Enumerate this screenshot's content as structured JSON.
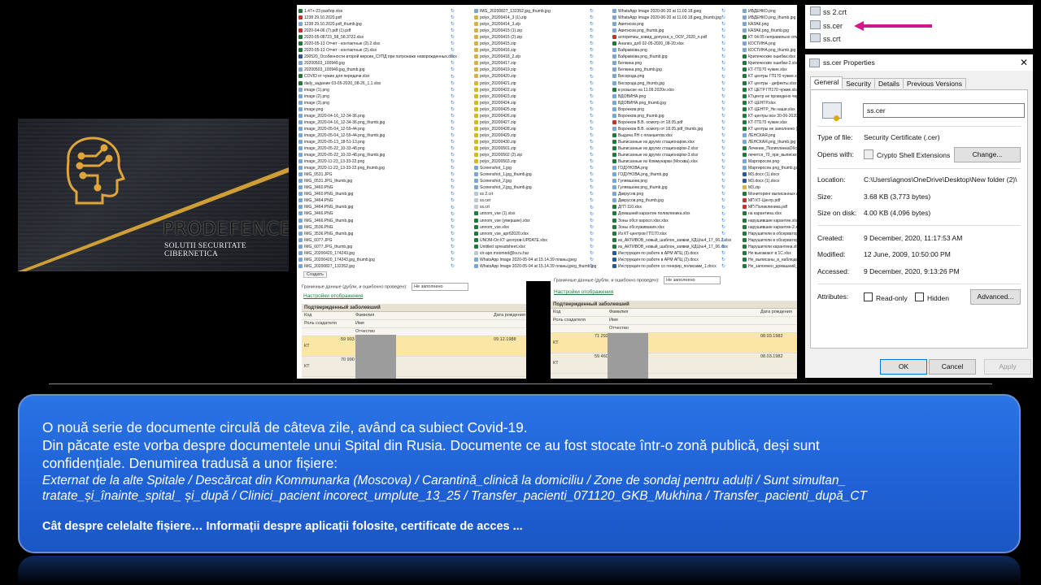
{
  "logo": {
    "brand": "PRODEFENCE",
    "tagline": "SOLUTII SECURITATE CIBERNETICA",
    "colors": {
      "gold": "#d9a437",
      "bg": "#1f2128"
    }
  },
  "listing": {
    "columns": [
      [
        "1.47+-23 разбор.xlsx",
        "1238 29.10.2020.pdf",
        "1238 29.10.2020.pdf_thumb.jpg",
        "2020-04-06 (7).pdf (1).pdf",
        "2020-05-08723_58_58.3722.xlsx",
        "2020-05-13 Отчет - контактные (2).2.xlsx",
        "2020-05-13 Отчет - контактные (2).xlsx",
        "200520_Особенности второй версии_СУПД при патронаже новорожденных.docx",
        "20200503_100949.jpg",
        "20200503_100949.jpg_thumb.jpg",
        "COVID кт чужие для передачи.xlsx",
        "daily_задание 03-05-2020_08-26_1,1.xlsx",
        "image (1).png",
        "image (2).png",
        "image (3).png",
        "image.png",
        "image_2020-04-16_12-34-36.png",
        "image_2020-04-16_12-34-36.png_thumb.jpg",
        "image_2020-05-04_12-59-44.png",
        "image_2020-05-04_12-59-44.png_thumb.jpg",
        "image_2020-05-13_18-51-13.png",
        "image_2020-05-22_10-33-48.png",
        "image_2020-05-22_10-33-48.png_thumb.jpg",
        "image_2020-11-23_13-33-22.png",
        "image_2020-11-23_13-33-22.png_thumb.jpg",
        "IMG_0531.JPG",
        "IMG_0531.JPG_thumb.jpg",
        "IMG_3460.PNG",
        "IMG_3460.PNG_thumb.jpg",
        "IMG_3464.PNG",
        "IMG_3464.PNG_thumb.jpg",
        "IMG_3466.PNG",
        "IMG_3466.PNG_thumb.jpg",
        "IMG_3536.PNG",
        "IMG_3536.PNG_thumb.jpg",
        "IMG_6077.JPG",
        "IMG_6077.JPG_thumb.jpg",
        "IMG_20200420_174243.jpg",
        "IMG_20200420_174243.jpg_thumb.jpg",
        "IMG_20200827_132352.jpg"
      ],
      [
        "IMG_20200827_132352.jpg_thumb.jpg",
        "polyx_20200414_3 (1).zip",
        "polyx_20200414_3.zip",
        "polyx_20200415 (1).zip",
        "polyx_20200415 (2).zip",
        "polyx_20200415.zip",
        "polyx_20200416.zip",
        "polyx_20200418_2.zip",
        "polyx_20200417.zip",
        "polyx_20200419.zip",
        "polyx_20200420.zip",
        "polyx_20200421.zip",
        "polyx_20200422.zip",
        "polyx_20200423.zip",
        "polyx_20200424.zip",
        "polyx_20200425.zip",
        "polyx_20200426.zip",
        "polyx_20200427.zip",
        "polyx_20200428.zip",
        "polyx_20200429.zip",
        "polyx_20200430.zip",
        "polyx_20200501.zip",
        "polyx_20200502 (2).zip",
        "polyx_20200503.zip",
        "Screenshot_1.jpg",
        "Screenshot_1.jpg_thumb.jpg",
        "Screenshot_2.jpg",
        "Screenshot_2.jpg_thumb.jpg",
        "ss 2.crt",
        "ss.cer",
        "ss.crt",
        "unnom_vse (1).xlsx",
        "unnom_vse (умершие).xlsx",
        "unnom_vse.xlsx",
        "unnom_vse_apr62020.xlsx",
        "UNOM-Ол КТ центров-UPDATE.xlsx",
        "Untitled spreadsheet.xlsx",
        "vir-apo.moomed@kv.ru.har",
        "WhatsApp Image 2020-05-04 at 15.14.39 планы.jpeg",
        "WhatsApp Image 2020-05-04 at 15.14.39 планы.jpeg_thumb.jpg"
      ],
      [
        "WhatsApp Image 2020-06-20 at 11.03.18.jpeg",
        "WhatsApp Image 2020-06-20 at 11.03.18.jpeg_thumb.jpg",
        "Авитисов.png",
        "Авитисов.png_thumb.jpg",
        "алгоритмы_ковид_допуска_к_ООУ_2020_n.pdf",
        "Анализ_доб 02-05-2020_08-20.xlsx",
        "Байрамова.png",
        "Байрамова.png_thumb.jpg",
        "Белкина.png",
        "Белкина.png_thumb.jpg",
        "Бисорода.png",
        "Бисорода.png_thumb.jpg",
        "в розыске на 11.09.2020н.xlsx",
        "ВДОВИНА.png",
        "ВДОВИНА.png_thumb.jpg",
        "Воронков.png",
        "Воронков.png_thumb.jpg",
        "Воронков В.В. осмотр от 18.05.pdf",
        "Воронков В.В. осмотр от 18.05.pdf_thumb.jpg",
        "Выдача ЛН с планшетов.xlsx",
        "Выписанные из других стационаров.xlsx",
        "Выписанные из других стационаров-2.xlsx",
        "Выписанные из других стационаров-3.xlsx",
        "Выписанные из Коммунарки (Москва).xlsx",
        "ГОДУНОВА.png",
        "ГОДУНОВА.png_thumb.jpg",
        "Гулямшоев.png",
        "Гулямшоев.png_thumb.jpg",
        "Двкрусов.png",
        "Двкрусов.png_thumb.jpg",
        "ДГП 110.xlsx",
        "Домашний карантин поликлиника.xlsx",
        "Зоны обсл взросл.xlsx.xlsx",
        "Зоны обслуживания.xlsx",
        "Из КТ-центров ГП170.xlsx",
        "из_АКТИВОВ_новый_шаблон_заявки_КДЦ№4_17_06.2.xlsx",
        "из_АКТИВОВ_новый_шаблон_заявки_КДЦ№4_17_06.xlsx",
        "Инструкция по работе в АРМ АПЦ (3).docx",
        "Инструкция по работе в АРМ АПЦ (2).docx",
        "Инструкция по работе со генерир_полисами_1.docx"
      ],
      [
        "ИВДЕНКО.png",
        "ИВДЕНКО.png_thumb.jpg",
        "КАЗАК.png",
        "КАЗАК.png_thumb.jpg",
        "КТ 04.05 неправильно отмеченные.xlsx",
        "КОСТИНА.png",
        "КОСТИНА.png_thumb.jpg",
        "Критические ошибки.xlsx",
        "Критические ошибки-2.xlsx",
        "КТ-ГП170 чужие.xlsx",
        "КТ центры ГП170 чужие.xlsx",
        "КТ центры - дефекты.xlsx",
        "КТ ЦЕТР ГП170 чужие.xlsx",
        "КТцентр не проведено через.xlsx",
        "КТ-ЦЕНТР.xlsx",
        "КТ-ЦЕНТР_Не наши.xlsx",
        "КТ-центры все 30-06-2020.xlsx",
        "КТ-ГП170 чужие.xlsx",
        "КТ центры не заполнено (1).xlsx",
        "ЛЕНСКАЯ.png",
        "ЛЕНСКАЯ.png_thumb.jpg",
        "Лечение_ПолиплинкаОбследование.xlsx",
        "лечется_70_при_выписке_из_стационара.xlsx",
        "Мартиросян.png",
        "Мартиросян.png_thumb.jpg",
        "М3.docx (1).docx",
        "М3.docx (1).docx",
        "М3.zip",
        "Мониторинг выписанных из стационара.xlsx",
        "МП КТ-Центр.pdf",
        "МП Поликлиника.pdf",
        "на карантина.xlsx",
        "нарушившие карантин.xlsx",
        "нарушившие карантин-2.xlsx",
        "Нарушители в обсерваторе.xlsx",
        "Нарушители в обсерваторе-2.xlsx",
        "Нарушители карантина.xlsx",
        "Не выезжают в 1С.xlsx",
        "Не_выписаны_в_наблюдении.xlsx",
        "Не_заполнен_домашний_карантин.xlsx"
      ]
    ],
    "create_button": "Создать"
  },
  "panel_left": {
    "combo_label": "Граничные данные (дубли, и ошибочно проведен):",
    "combo_value": "Не заполнено",
    "link": "Настройки отображения",
    "title": "Подтвержденный заболевший",
    "headers": {
      "code": "Код",
      "role": "Роль создателя",
      "surname": "Фамилия",
      "name": "Имя",
      "patronymic": "Отчество",
      "dob": "Дата рождения"
    },
    "rows": [
      {
        "role": "КТ",
        "code": "59 903",
        "dob": "09.12.1988"
      },
      {
        "role": "КТ",
        "code": "70 990",
        "dob": "09.12.1988"
      }
    ]
  },
  "panel_right": {
    "combo_label": "Граничные данные (дубли, и ошибочно проведен):",
    "combo_value": "Не заполнено",
    "link": "Настройки отображения",
    "title": "Подтвержденный заболевший",
    "headers": {
      "code": "Код",
      "role": "Роль создателя",
      "surname": "Фамилия",
      "name": "Имя",
      "patronymic": "Отчество",
      "dob": "Дата рождения"
    },
    "rows": [
      {
        "role": "КТ",
        "code": "71 292",
        "dob": "08.03.1982"
      },
      {
        "role": "КТ",
        "code": "59 460",
        "dob": "08.03.1982"
      }
    ]
  },
  "cert_files": [
    "ss 2.crt",
    "ss.cer",
    "ss.crt"
  ],
  "arrow_color": "#d0178f",
  "properties": {
    "title": "ss.cer Properties",
    "tabs": [
      "General",
      "Security",
      "Details",
      "Previous Versions"
    ],
    "file_name": "ss.cer",
    "type_label": "Type of file:",
    "type_value": "Security Certificate (.cer)",
    "opens_label": "Opens with:",
    "opens_value": "Crypto Shell Extensions",
    "change_button": "Change...",
    "location_label": "Location:",
    "location_value": "C:\\Users\\agnos\\OneDrive\\Desktop\\New folder (2)\\",
    "size_label": "Size:",
    "size_value": "3.68 KB (3,773 bytes)",
    "disk_label": "Size on disk:",
    "disk_value": "4.00 KB (4,096 bytes)",
    "created_label": "Created:",
    "created_value": "9 December, 2020, 11:17:53 AM",
    "modified_label": "Modified:",
    "modified_value": "12 June, 2009, 10:50:00 PM",
    "accessed_label": "Accessed:",
    "accessed_value": "9 December, 2020, 9:13:26 PM",
    "attributes_label": "Attributes:",
    "readonly_label": "Read-only",
    "hidden_label": "Hidden",
    "advanced_button": "Advanced...",
    "ok_button": "OK",
    "cancel_button": "Cancel",
    "apply_button": "Apply"
  },
  "text": {
    "line1": "O nouă serie de documente circulă de câteva zile, având ca subiect Covid-19.",
    "line2": "Din păcate este vorba despre documentele unui Spital din Rusia. Documente ce au fost stocate într-o zonă publică, deși sunt",
    "line3": "confidențiale. Denumirea tradusă a unor fișiere:",
    "italic1": "Externat de la alte Spitale / Descărcat din Kommunarka (Moscova) / Carantină_clinică la domiciliu / Zone de sondaj pentru adulți / Sunt simultan_",
    "italic2": "tratate_și_înainte_spital_ și_după / Clinici_pacient incorect_umplute_13_25 / Transfer_pacienti_071120_GKB_Mukhina / Transfer_pacienti_după_CT",
    "bold": "Cât despre celelalte fișiere… Informații despre aplicații folosite, certificate de acces ..."
  },
  "colors": {
    "box": "#2468d8",
    "box_border": "#6e8fce",
    "background": "#000000"
  }
}
